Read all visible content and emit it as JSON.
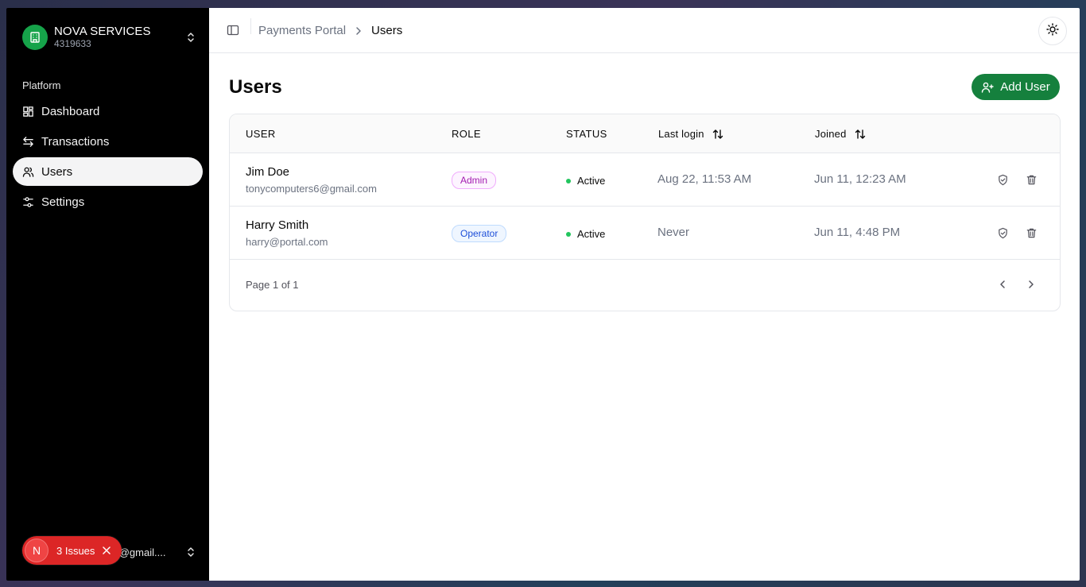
{
  "sidebar": {
    "org_name": "NOVA SERVICES",
    "org_id": "4319633",
    "section_label": "Platform",
    "items": [
      {
        "label": "Dashboard",
        "icon": "dashboard-icon",
        "active": false
      },
      {
        "label": "Transactions",
        "icon": "arrows-left-right-icon",
        "active": false
      },
      {
        "label": "Users",
        "icon": "users-icon",
        "active": true
      },
      {
        "label": "Settings",
        "icon": "settings-sliders-icon",
        "active": false
      }
    ],
    "footer_email": "tonycomputers6@gmail.com",
    "footer_email_visible": "s6@gmail....",
    "issues": {
      "badge": "N",
      "label": "3 Issues",
      "color": "#dc2626"
    }
  },
  "topbar": {
    "breadcrumb": {
      "parent": "Payments Portal",
      "current": "Users"
    }
  },
  "page": {
    "title": "Users",
    "add_button_label": "Add User",
    "accent_color": "#15803d"
  },
  "table": {
    "columns": [
      "USER",
      "ROLE",
      "STATUS",
      "Last login",
      "Joined"
    ],
    "rows": [
      {
        "name": "Jim Doe",
        "email": "tonycomputers6@gmail.com",
        "role": "Admin",
        "status": "Active",
        "last_login": "Aug 22, 11:53 AM",
        "joined": "Jun 11, 12:23 AM"
      },
      {
        "name": "Harry Smith",
        "email": "harry@portal.com",
        "role": "Operator",
        "status": "Active",
        "last_login": "Never",
        "joined": "Jun 11, 4:48 PM"
      }
    ],
    "pagination": "Page 1 of 1"
  }
}
